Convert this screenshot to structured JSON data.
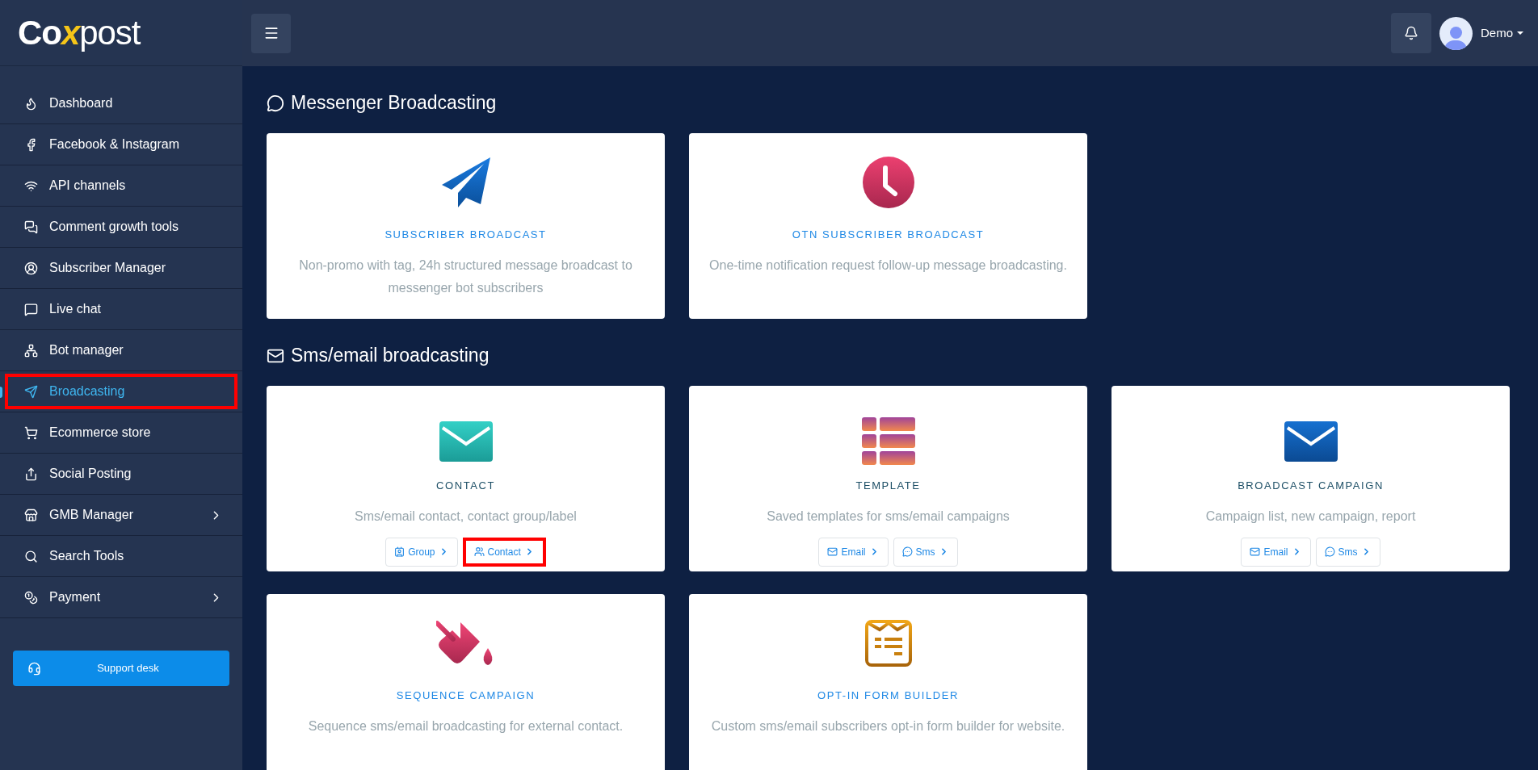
{
  "brand": {
    "name_start": "Co",
    "name_mark": "x",
    "name_end": "post"
  },
  "header": {
    "user": "Demo"
  },
  "sidebar": {
    "items": [
      {
        "label": "Dashboard",
        "selected": false,
        "expandable": false,
        "highlighted": false
      },
      {
        "label": "Facebook & Instagram",
        "selected": false,
        "expandable": false,
        "highlighted": false
      },
      {
        "label": "API channels",
        "selected": false,
        "expandable": false,
        "highlighted": false
      },
      {
        "label": "Comment growth tools",
        "selected": false,
        "expandable": false,
        "highlighted": false
      },
      {
        "label": "Subscriber Manager",
        "selected": false,
        "expandable": false,
        "highlighted": false
      },
      {
        "label": "Live chat",
        "selected": false,
        "expandable": false,
        "highlighted": false
      },
      {
        "label": "Bot manager",
        "selected": false,
        "expandable": false,
        "highlighted": false
      },
      {
        "label": "Broadcasting",
        "selected": true,
        "expandable": false,
        "highlighted": true
      },
      {
        "label": "Ecommerce store",
        "selected": false,
        "expandable": false,
        "highlighted": false
      },
      {
        "label": "Social Posting",
        "selected": false,
        "expandable": false,
        "highlighted": false
      },
      {
        "label": "GMB Manager",
        "selected": false,
        "expandable": true,
        "highlighted": false
      },
      {
        "label": "Search Tools",
        "selected": false,
        "expandable": false,
        "highlighted": false
      },
      {
        "label": "Payment",
        "selected": false,
        "expandable": true,
        "highlighted": false
      }
    ],
    "support_button": "Support desk"
  },
  "sections": [
    {
      "title": "Messenger Broadcasting",
      "cards": [
        {
          "title": "SUBSCRIBER BROADCAST",
          "color": "#1e88e5",
          "description": "Non-promo with tag, 24h structured message broadcast to messenger bot subscribers"
        },
        {
          "title": "OTN SUBSCRIBER BROADCAST",
          "color": "#1e88e5",
          "description": "One-time notification request follow-up message broadcasting."
        }
      ]
    },
    {
      "title": "Sms/email broadcasting",
      "cards": [
        {
          "title": "CONTACT",
          "color": "#1d4f66",
          "description": "Sms/email contact, contact group/label",
          "buttons": [
            {
              "label": "Group",
              "highlighted": false
            },
            {
              "label": "Contact",
              "highlighted": true
            }
          ]
        },
        {
          "title": "TEMPLATE",
          "color": "#1d4f66",
          "description": "Saved templates for sms/email campaigns",
          "buttons": [
            {
              "label": "Email",
              "highlighted": false
            },
            {
              "label": "Sms",
              "highlighted": false
            }
          ]
        },
        {
          "title": "BROADCAST CAMPAIGN",
          "color": "#1d4f66",
          "description": "Campaign list, new campaign, report",
          "buttons": [
            {
              "label": "Email",
              "highlighted": false
            },
            {
              "label": "Sms",
              "highlighted": false
            }
          ]
        },
        {
          "title": "SEQUENCE CAMPAIGN",
          "color": "#1e88e5",
          "description": "Sequence sms/email broadcasting for external contact."
        },
        {
          "title": "OPT-IN FORM BUILDER",
          "color": "#1e88e5",
          "description": "Custom sms/email subscribers opt-in form builder for website."
        }
      ]
    }
  ]
}
